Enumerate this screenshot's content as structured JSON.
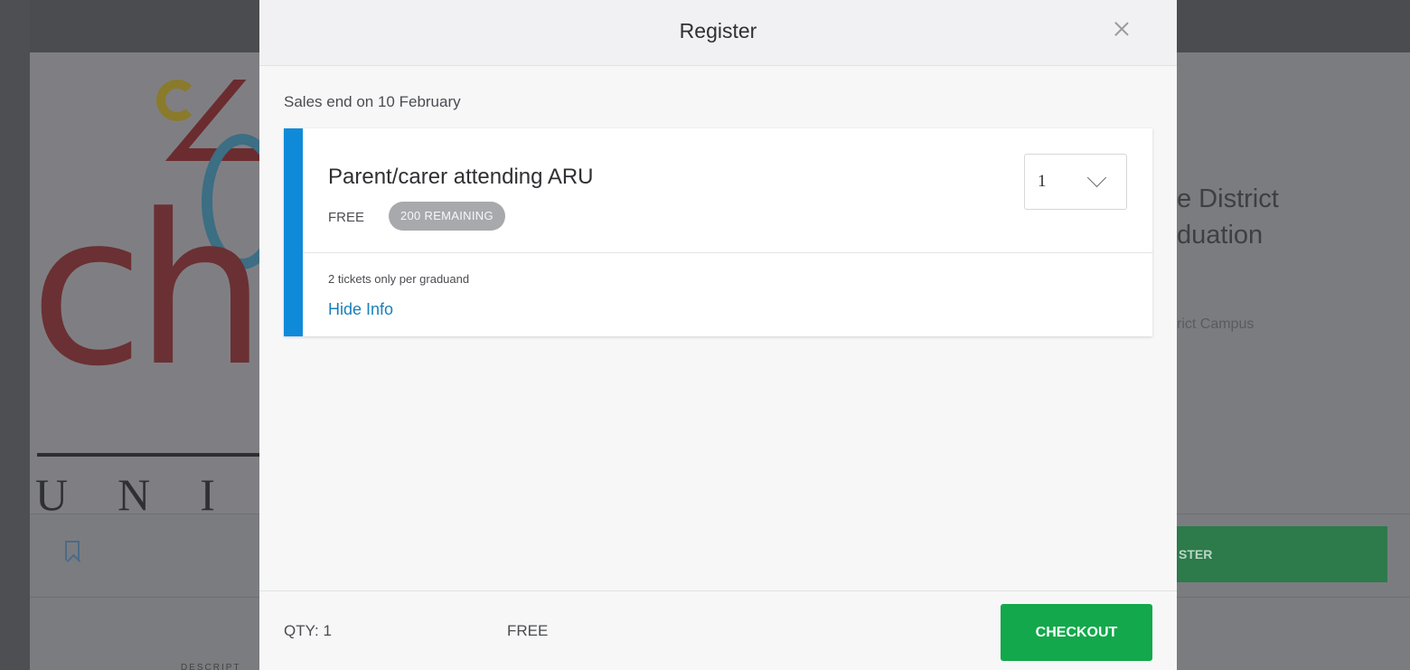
{
  "background_page": {
    "event_title": "e District\nduation",
    "event_location": "rict Campus",
    "register_button_label": "STER",
    "logo_letters": "ch",
    "logo_subtext": "UNI",
    "tab_label": "DESCRIPT"
  },
  "modal": {
    "title": "Register",
    "sales_end": "Sales end on 10 February",
    "ticket": {
      "name": "Parent/carer attending ARU",
      "price": "FREE",
      "remaining_badge": "200 REMAINING",
      "quantity_selected": "1",
      "note": "2 tickets only per graduand",
      "toggle_info_label": "Hide Info"
    },
    "footer": {
      "qty_label": "QTY: 1",
      "total": "FREE",
      "checkout_label": "CHECKOUT"
    }
  },
  "colors": {
    "accent": "#0f8ad9",
    "checkout": "#13a84b",
    "link": "#1a7fb8",
    "badge": "#a8a9ad"
  },
  "icons": {
    "close": "close-icon",
    "dropdown": "chevron-down-icon",
    "bookmark": "bookmark-icon"
  }
}
